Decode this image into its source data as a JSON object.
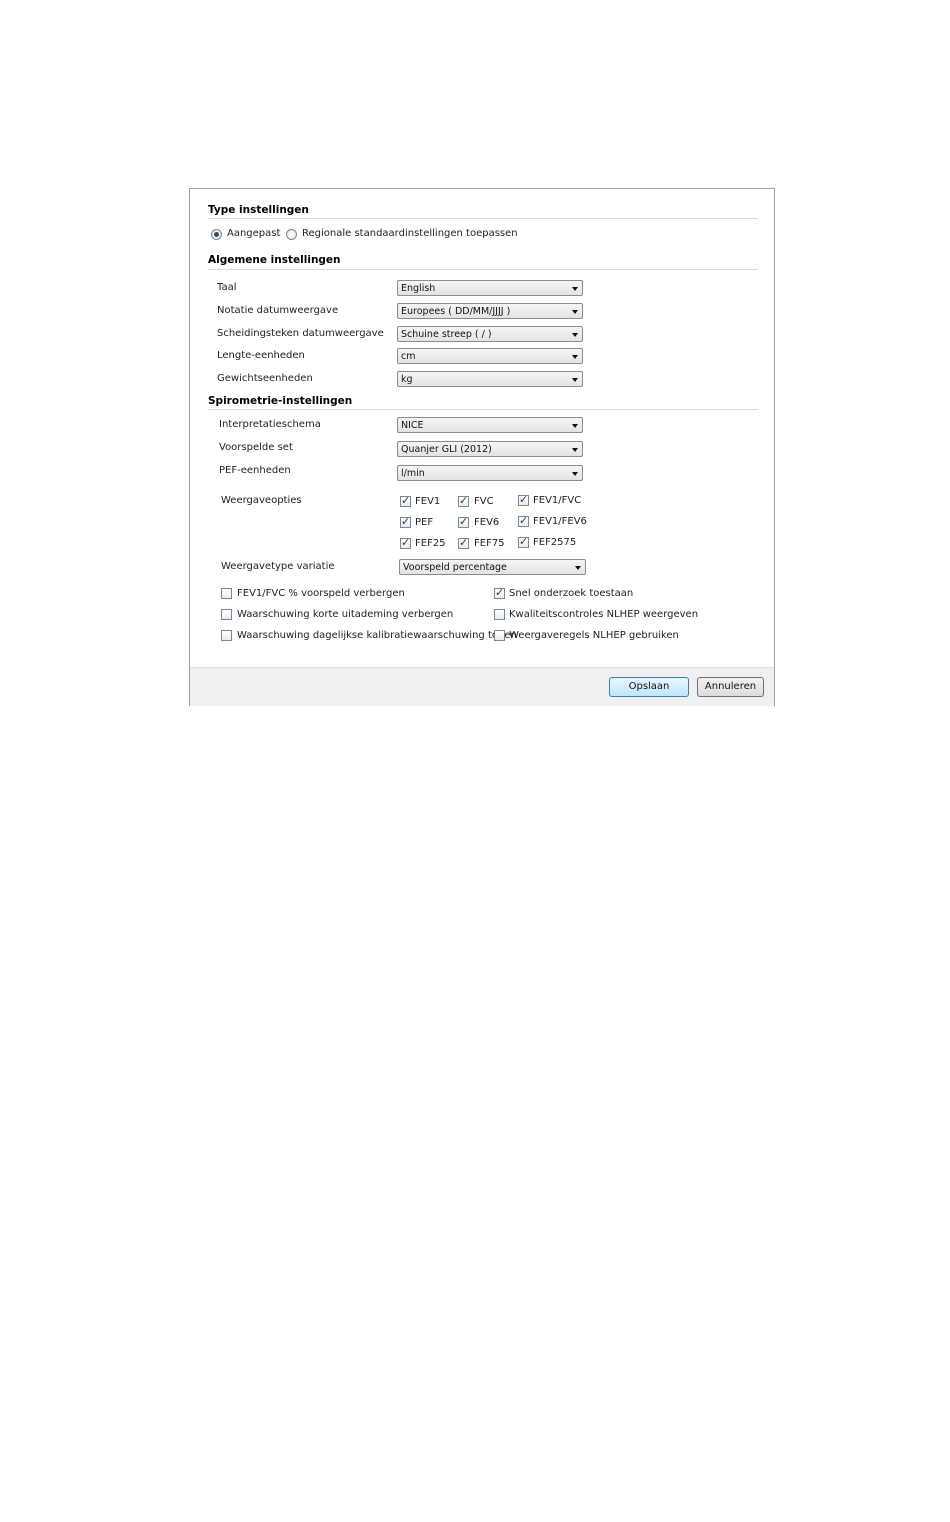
{
  "type_settings": {
    "title": "Type instellingen",
    "options": [
      {
        "label": "Aangepast",
        "selected": true
      },
      {
        "label": "Regionale standaardinstellingen toepassen",
        "selected": false
      }
    ]
  },
  "general_settings": {
    "title": "Algemene instellingen",
    "rows": [
      {
        "label": "Taal",
        "value": "English"
      },
      {
        "label": "Notatie datumweergave",
        "value": "Europees ( DD/MM/JJJJ )"
      },
      {
        "label": "Scheidingsteken datumweergave",
        "value": "Schuine streep ( / )"
      },
      {
        "label": "Lengte-eenheden",
        "value": "cm"
      },
      {
        "label": "Gewichtseenheden",
        "value": "kg"
      }
    ]
  },
  "spirometry_settings": {
    "title": "Spirometrie-instellingen",
    "rows": [
      {
        "label": "Interpretatieschema",
        "value": "NICE"
      },
      {
        "label": "Voorspelde set",
        "value": "Quanjer GLI (2012)"
      },
      {
        "label": "PEF-eenheden",
        "value": "l/min"
      }
    ],
    "display_options_label": "Weergaveopties",
    "display_options": [
      {
        "label": "FEV1",
        "checked": true
      },
      {
        "label": "FVC",
        "checked": true
      },
      {
        "label": "FEV1/FVC",
        "checked": true
      },
      {
        "label": "PEF",
        "checked": true
      },
      {
        "label": "FEV6",
        "checked": true
      },
      {
        "label": "FEV1/FEV6",
        "checked": true
      },
      {
        "label": "FEF25",
        "checked": true
      },
      {
        "label": "FEF75",
        "checked": true
      },
      {
        "label": "FEF2575",
        "checked": true
      }
    ],
    "variation_label": "Weergavetype variatie",
    "variation_value": "Voorspeld percentage",
    "flags_left": [
      {
        "label": "FEV1/FVC % voorspeld verbergen",
        "checked": false
      },
      {
        "label": "Waarschuwing korte uitademing verbergen",
        "checked": false
      },
      {
        "label": "Waarschuwing dagelijkse kalibratiewaarschuwing tonen",
        "checked": false
      }
    ],
    "flags_right": [
      {
        "label": "Snel onderzoek toestaan",
        "checked": true
      },
      {
        "label": "Kwaliteitscontroles NLHEP weergeven",
        "checked": false
      },
      {
        "label": "Weergaveregels NLHEP gebruiken",
        "checked": false
      }
    ]
  },
  "buttons": {
    "save": "Opslaan",
    "cancel": "Annuleren"
  },
  "icons": {
    "check": "✓",
    "dropdown": "chevron-down-icon"
  }
}
